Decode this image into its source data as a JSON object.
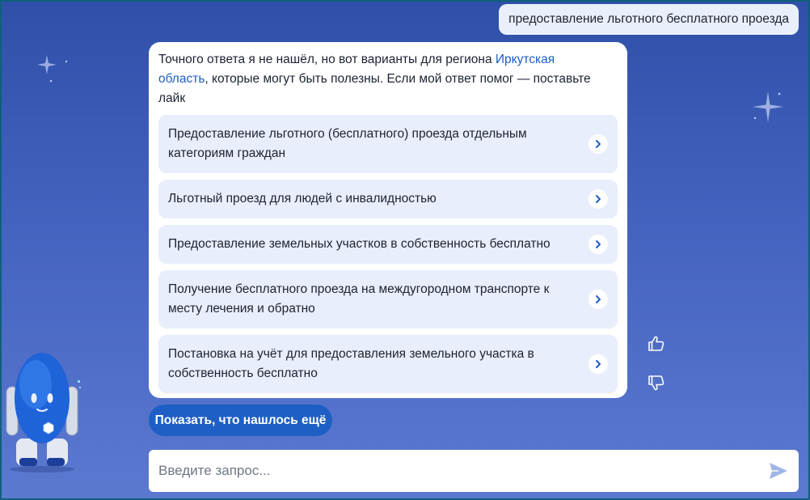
{
  "chat": {
    "user_message": "предоставление льготного бесплатного проезда",
    "bot": {
      "text_before": "Точного ответа я не нашёл, но вот варианты для региона ",
      "region_link": "Иркутская область",
      "text_after": ", которые могут быть полезны. Если мой ответ помог — поставьте лайк"
    },
    "options": [
      {
        "label": "Предоставление льготного (бесплатного) проезда отдельным категориям граждан"
      },
      {
        "label": "Льготный проезд для людей с инвалидностью"
      },
      {
        "label": "Предоставление земельных участков в собственность бесплатно"
      },
      {
        "label": "Получение бесплатного проезда на междугородном транспорте к месту лечения и обратно"
      },
      {
        "label": "Постановка на учёт для предоставления земельного участка в собственность бесплатно"
      }
    ],
    "show_more_label": "Показать, что нашлось ещё"
  },
  "input": {
    "placeholder": "Введите запрос...",
    "value": ""
  },
  "icons": {
    "option_chevron": "chevron-right-icon",
    "like": "thumbs-up-icon",
    "dislike": "thumbs-down-icon",
    "send": "send-icon",
    "mascot": "robot-mascot"
  },
  "colors": {
    "accent": "#1d5fc5",
    "background_top": "#2f4fa8",
    "background_bottom": "#5b79cf",
    "option_bg": "#e8eefb",
    "user_bubble_bg": "#eaf0fb"
  }
}
